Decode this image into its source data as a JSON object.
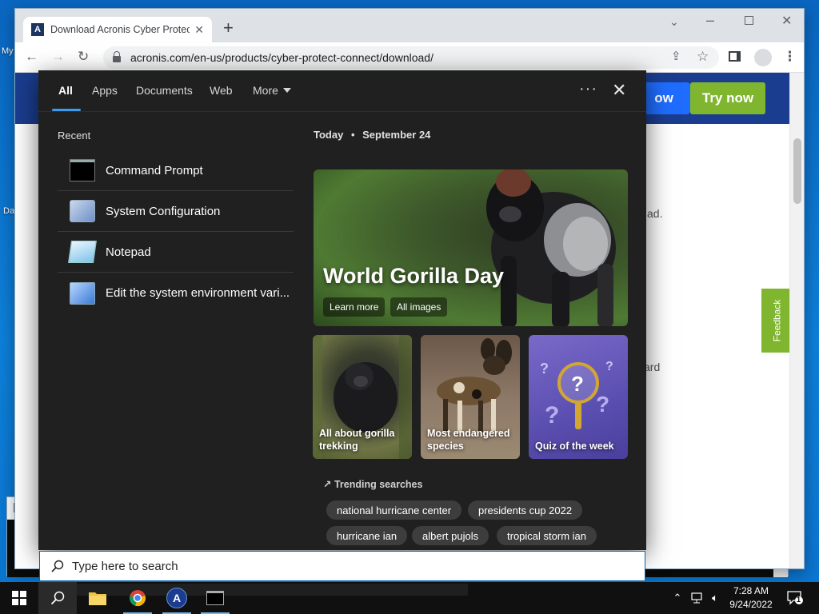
{
  "desktop": {
    "icon1_label": "My",
    "icon2_label": "Da"
  },
  "browser": {
    "tab_title": "Download Acronis Cyber Protect",
    "favicon_letter": "A",
    "url": "acronis.com/en-us/products/cyber-protect-connect/download/",
    "page": {
      "partial_button": "ow",
      "try_now": "Try now",
      "frag1": "ad.",
      "frag2": "ard",
      "feedback": "Feedback"
    }
  },
  "search": {
    "tabs": [
      {
        "label": "All",
        "active": true
      },
      {
        "label": "Apps"
      },
      {
        "label": "Documents"
      },
      {
        "label": "Web"
      },
      {
        "label": "More"
      }
    ],
    "recent_heading": "Recent",
    "recent": [
      {
        "label": "Command Prompt",
        "icon": "command-prompt-icon"
      },
      {
        "label": "System Configuration",
        "icon": "system-configuration-icon"
      },
      {
        "label": "Notepad",
        "icon": "notepad-icon"
      },
      {
        "label": "Edit the system environment vari...",
        "icon": "environment-variables-icon"
      }
    ],
    "today_label": "Today",
    "date": "September 24",
    "hero": {
      "title": "World Gorilla Day",
      "learn_more": "Learn more",
      "all_images": "All images"
    },
    "cards": [
      {
        "caption": "All about gorilla trekking"
      },
      {
        "caption": "Most endangered species"
      },
      {
        "caption": "Quiz of the week"
      }
    ],
    "trending_heading": "Trending searches",
    "trending": [
      "national hurricane center",
      "presidents cup 2022",
      "hurricane ian",
      "albert pujols",
      "tropical storm ian"
    ],
    "placeholder": "Type here to search"
  },
  "taskbar": {
    "time": "7:28 AM",
    "date": "9/24/2022",
    "notification_count": "1",
    "colors": {
      "accent": "#76b9ed",
      "chrome_red": "#db4437",
      "chrome_green": "#0f9d58",
      "chrome_yellow": "#f4b400"
    }
  }
}
